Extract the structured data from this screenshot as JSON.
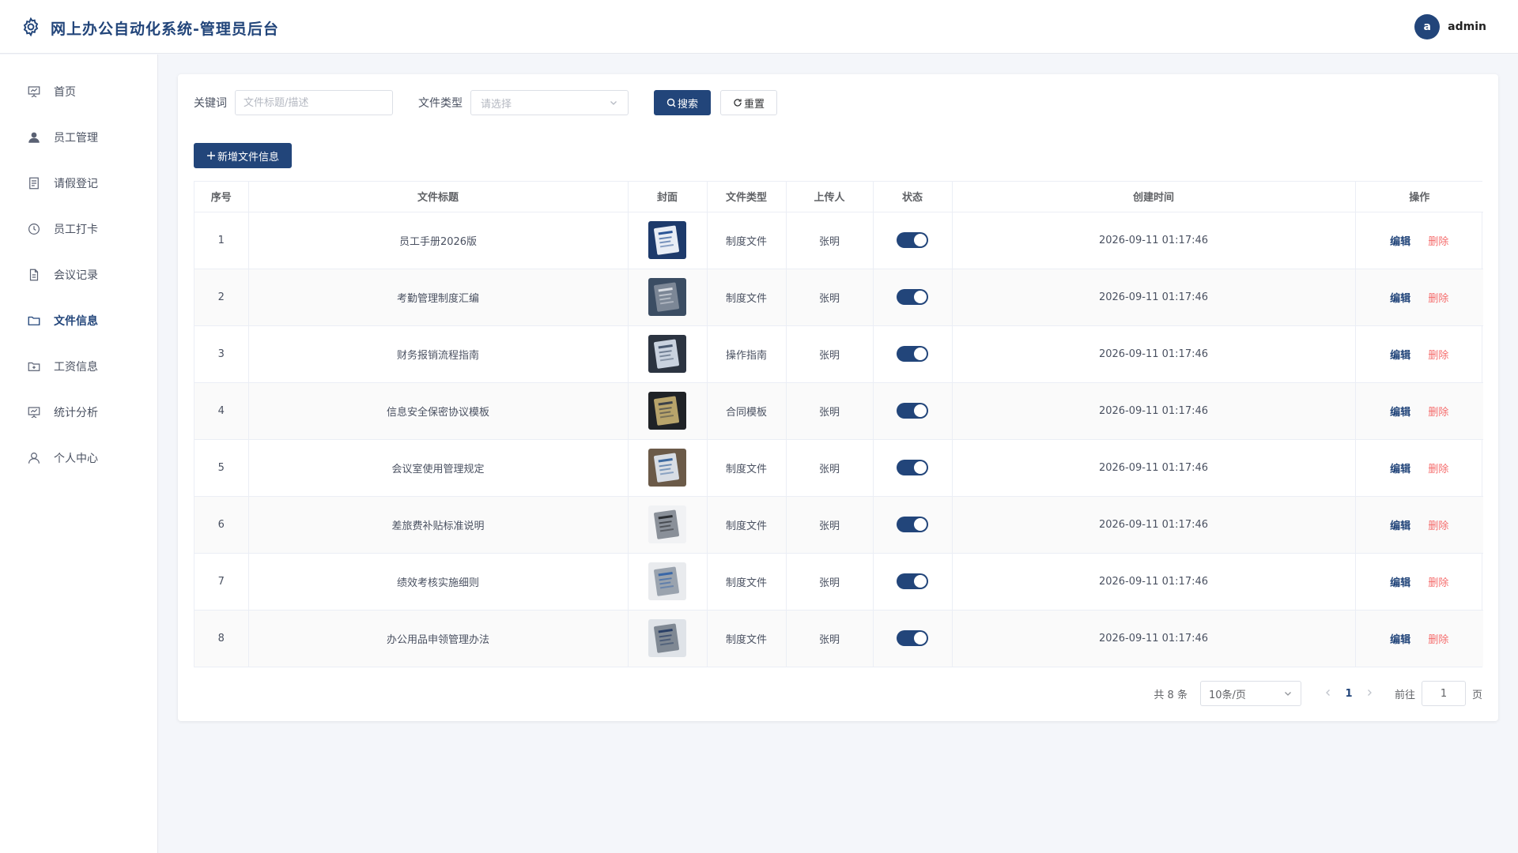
{
  "header": {
    "title": "网上办公自动化系统-管理员后台",
    "avatar_letter": "a",
    "username": "admin"
  },
  "sidebar": {
    "items": [
      {
        "label": "首页",
        "icon": "presentation-icon",
        "active": false
      },
      {
        "label": "员工管理",
        "icon": "user-filled-icon",
        "active": false
      },
      {
        "label": "请假登记",
        "icon": "document-list-icon",
        "active": false
      },
      {
        "label": "员工打卡",
        "icon": "clock-icon",
        "active": false
      },
      {
        "label": "会议记录",
        "icon": "document-icon",
        "active": false
      },
      {
        "label": "文件信息",
        "icon": "folder-icon",
        "active": true
      },
      {
        "label": "工资信息",
        "icon": "folder-add-icon",
        "active": false
      },
      {
        "label": "统计分析",
        "icon": "presentation-icon",
        "active": false
      },
      {
        "label": "个人中心",
        "icon": "user-outline-icon",
        "active": false
      }
    ]
  },
  "filters": {
    "keyword_label": "关键词",
    "keyword_placeholder": "文件标题/描述",
    "keyword_value": "",
    "type_label": "文件类型",
    "type_placeholder": "请选择",
    "search_label": "搜索",
    "reset_label": "重置"
  },
  "toolbar": {
    "add_label": "新增文件信息"
  },
  "table": {
    "columns": [
      "序号",
      "文件标题",
      "封面",
      "文件类型",
      "上传人",
      "状态",
      "创建时间",
      "操作"
    ],
    "rows": [
      {
        "index": "1",
        "title": "员工手册2026版",
        "type": "制度文件",
        "uploader": "张明",
        "status": true,
        "created": "2026-09-11 01:17:46"
      },
      {
        "index": "2",
        "title": "考勤管理制度汇编",
        "type": "制度文件",
        "uploader": "张明",
        "status": true,
        "created": "2026-09-11 01:17:46"
      },
      {
        "index": "3",
        "title": "财务报销流程指南",
        "type": "操作指南",
        "uploader": "张明",
        "status": true,
        "created": "2026-09-11 01:17:46"
      },
      {
        "index": "4",
        "title": "信息安全保密协议模板",
        "type": "合同模板",
        "uploader": "张明",
        "status": true,
        "created": "2026-09-11 01:17:46"
      },
      {
        "index": "5",
        "title": "会议室使用管理规定",
        "type": "制度文件",
        "uploader": "张明",
        "status": true,
        "created": "2026-09-11 01:17:46"
      },
      {
        "index": "6",
        "title": "差旅费补贴标准说明",
        "type": "制度文件",
        "uploader": "张明",
        "status": true,
        "created": "2026-09-11 01:17:46"
      },
      {
        "index": "7",
        "title": "绩效考核实施细则",
        "type": "制度文件",
        "uploader": "张明",
        "status": true,
        "created": "2026-09-11 01:17:46"
      },
      {
        "index": "8",
        "title": "办公用品申领管理办法",
        "type": "制度文件",
        "uploader": "张明",
        "status": true,
        "created": "2026-09-11 01:17:46"
      }
    ],
    "edit_label": "编辑",
    "delete_label": "删除"
  },
  "pagination": {
    "total_text": "共 8 条",
    "page_size": "10条/页",
    "current_page": "1",
    "goto_label": "前往",
    "goto_value": "1",
    "page_suffix": "页"
  },
  "colors": {
    "primary": "#22457a",
    "danger": "#f56c6c"
  }
}
